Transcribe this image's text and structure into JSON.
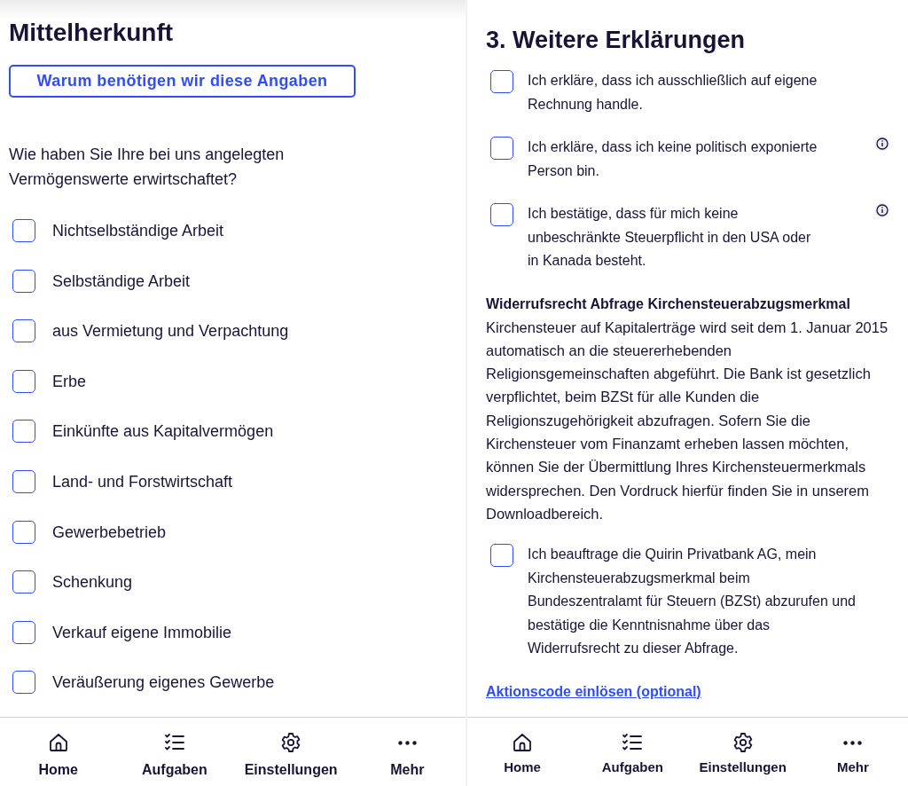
{
  "left_screen": {
    "title": "Mittelherkunft",
    "info_button": "Warum benötigen wir diese Angaben",
    "question": "Wie haben Sie Ihre bei uns angelegten Vermögenswerte erwirtschaftet?",
    "options": [
      {
        "label": "Nichtselbständige Arbeit",
        "checked": false
      },
      {
        "label": "Selbständige Arbeit",
        "checked": false
      },
      {
        "label": "aus Vermietung und Verpachtung",
        "checked": false
      },
      {
        "label": "Erbe",
        "checked": false
      },
      {
        "label": "Einkünfte aus Kapitalvermögen",
        "checked": false
      },
      {
        "label": "Land- und Forstwirtschaft",
        "checked": false
      },
      {
        "label": "Gewerbebetrieb",
        "checked": false
      },
      {
        "label": "Schenkung",
        "checked": false
      },
      {
        "label": "Verkauf eigene Immobilie",
        "checked": false
      },
      {
        "label": "Veräußerung eigenes Gewerbe",
        "checked": false
      }
    ],
    "nav": [
      {
        "kind": "home",
        "label": "Home"
      },
      {
        "kind": "tasks",
        "label": "Aufgaben"
      },
      {
        "kind": "settings",
        "label": "Einstellungen"
      },
      {
        "kind": "more",
        "label": "Mehr"
      }
    ]
  },
  "right_screen": {
    "title": "3. Weitere Erklärungen",
    "declarations": [
      {
        "text": "Ich erkläre, dass ich ausschließlich auf eigene Rechnung handle.",
        "checked": false,
        "info": false
      },
      {
        "text": "Ich erkläre, dass ich keine politisch exponierte Person bin.",
        "checked": false,
        "info": true
      },
      {
        "text": "Ich bestätige, dass für mich keine unbeschränkte Steuerpflicht in den USA oder in Kanada besteht.",
        "checked": false,
        "info": true
      }
    ],
    "section": {
      "heading": "Widerrufsrecht Abfrage Kirchensteuerabzugsmerkmal",
      "body": "Kirchensteuer auf Kapitalerträge wird seit dem 1. Januar 2015 automatisch an die steuererhebenden Religionsgemeinschaften abgeführt. Die Bank ist gesetzlich verpflichtet, beim BZSt für alle Kunden die Religionszugehörigkeit abzufragen. Sofern Sie die Kirchensteuer vom Finanzamt erheben lassen möchten, können Sie der Übermittlung Ihres Kirchensteuermerkmals widersprechen. Den Vordruck hierfür finden Sie in unserem Downloadbereich."
    },
    "consent": {
      "text": "Ich beauftrage die Quirin Privatbank AG, mein Kirchensteuerabzugsmerkmal beim Bundeszentralamt für Steuern (BZSt) abzurufen und bestätige die Kenntnisnahme über das Widerrufsrecht zu dieser Abfrage.",
      "checked": false
    },
    "link": "Aktionscode einlösen (optional)",
    "nav": [
      {
        "kind": "home",
        "label": "Home"
      },
      {
        "kind": "tasks",
        "label": "Aufgaben"
      },
      {
        "kind": "settings",
        "label": "Einstellungen"
      },
      {
        "kind": "more",
        "label": "Mehr"
      }
    ]
  }
}
